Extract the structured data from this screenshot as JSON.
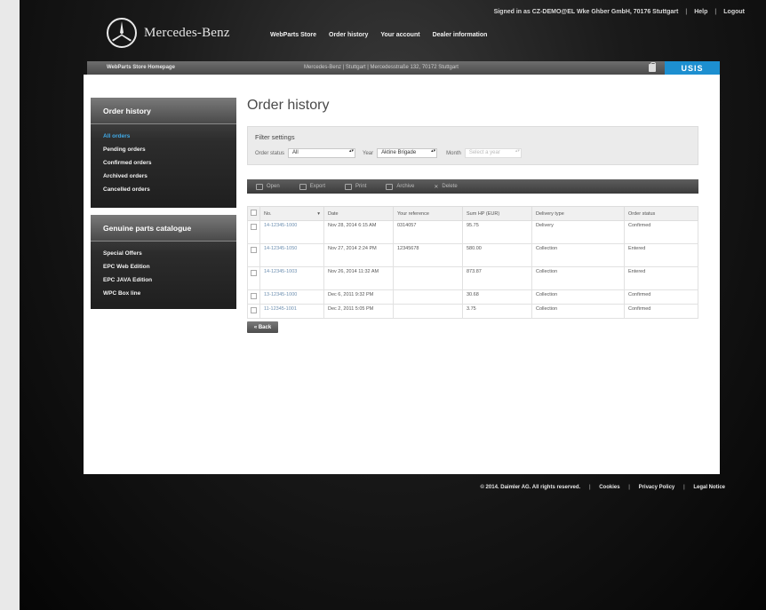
{
  "header": {
    "signed_in": "Signed in as CZ-DEMO@EL Wke Ghber GmbH, 70176 Stuttgart",
    "help": "Help",
    "logout": "Logout",
    "brand": "Mercedes-Benz",
    "nav": [
      "WebParts Store",
      "Order history",
      "Your account",
      "Dealer information"
    ]
  },
  "bar": {
    "home": "WebParts Store Homepage",
    "location": "Mercedes-Benz | Stuttgart | Mercedesstraße 132, 70172 Stuttgart",
    "lang": "USIS"
  },
  "sidebar": {
    "order_history": {
      "title": "Order history",
      "items": [
        "All orders",
        "Pending orders",
        "Confirmed orders",
        "Archived orders",
        "Cancelled orders"
      ]
    },
    "catalogue": {
      "title": "Genuine parts catalogue",
      "items": [
        "Special Offers",
        "EPC Web Edition",
        "EPC JAVA Edition",
        "WPC Box line"
      ]
    }
  },
  "page": {
    "title": "Order history",
    "filter": {
      "title": "Filter settings",
      "status_label": "Order status",
      "status_value": "All",
      "year_label": "Year",
      "year_value": "Aktine Brigade",
      "month_label": "Month",
      "month_value": "Select a year"
    },
    "toolbar": [
      "Open",
      "Export",
      "Print",
      "Archive",
      "Delete"
    ],
    "back_label": "« Back"
  },
  "table": {
    "columns": [
      "No.",
      "Date",
      "Your reference",
      "Sum HP (EUR)",
      "Delivery type",
      "Order status"
    ],
    "rows": [
      {
        "no": "14-12345-1000",
        "date": "Nov 28, 2014 6:15 AM",
        "ref": "0314057",
        "sum": "95.75",
        "delivery": "Delivery",
        "status": "Confirmed"
      },
      {
        "no": "14-12345-1050",
        "date": "Nov 27, 2014 2:24 PM",
        "ref": "12345678",
        "sum": "580.00",
        "delivery": "Collection",
        "status": "Entered"
      },
      {
        "no": "14-12345-1003",
        "date": "Nov 26, 2014 11:32 AM",
        "ref": "",
        "sum": "873.87",
        "delivery": "Collection",
        "status": "Entered"
      },
      {
        "no": "13-12345-1000",
        "date": "Dec 6, 2011 9:32 PM",
        "ref": "",
        "sum": "30.68",
        "delivery": "Collection",
        "status": "Confirmed"
      },
      {
        "no": "11-12345-1001",
        "date": "Dec 2, 2011 5:05 PM",
        "ref": "",
        "sum": "3.75",
        "delivery": "Collection",
        "status": "Confirmed"
      }
    ]
  },
  "footer": {
    "copyright": "© 2014. Daimler AG. All rights reserved.",
    "links": [
      "Cookies",
      "Privacy Policy",
      "Legal Notice"
    ]
  },
  "colors": {
    "accent": "#1d8fd0",
    "active_link": "#40a9e6"
  }
}
